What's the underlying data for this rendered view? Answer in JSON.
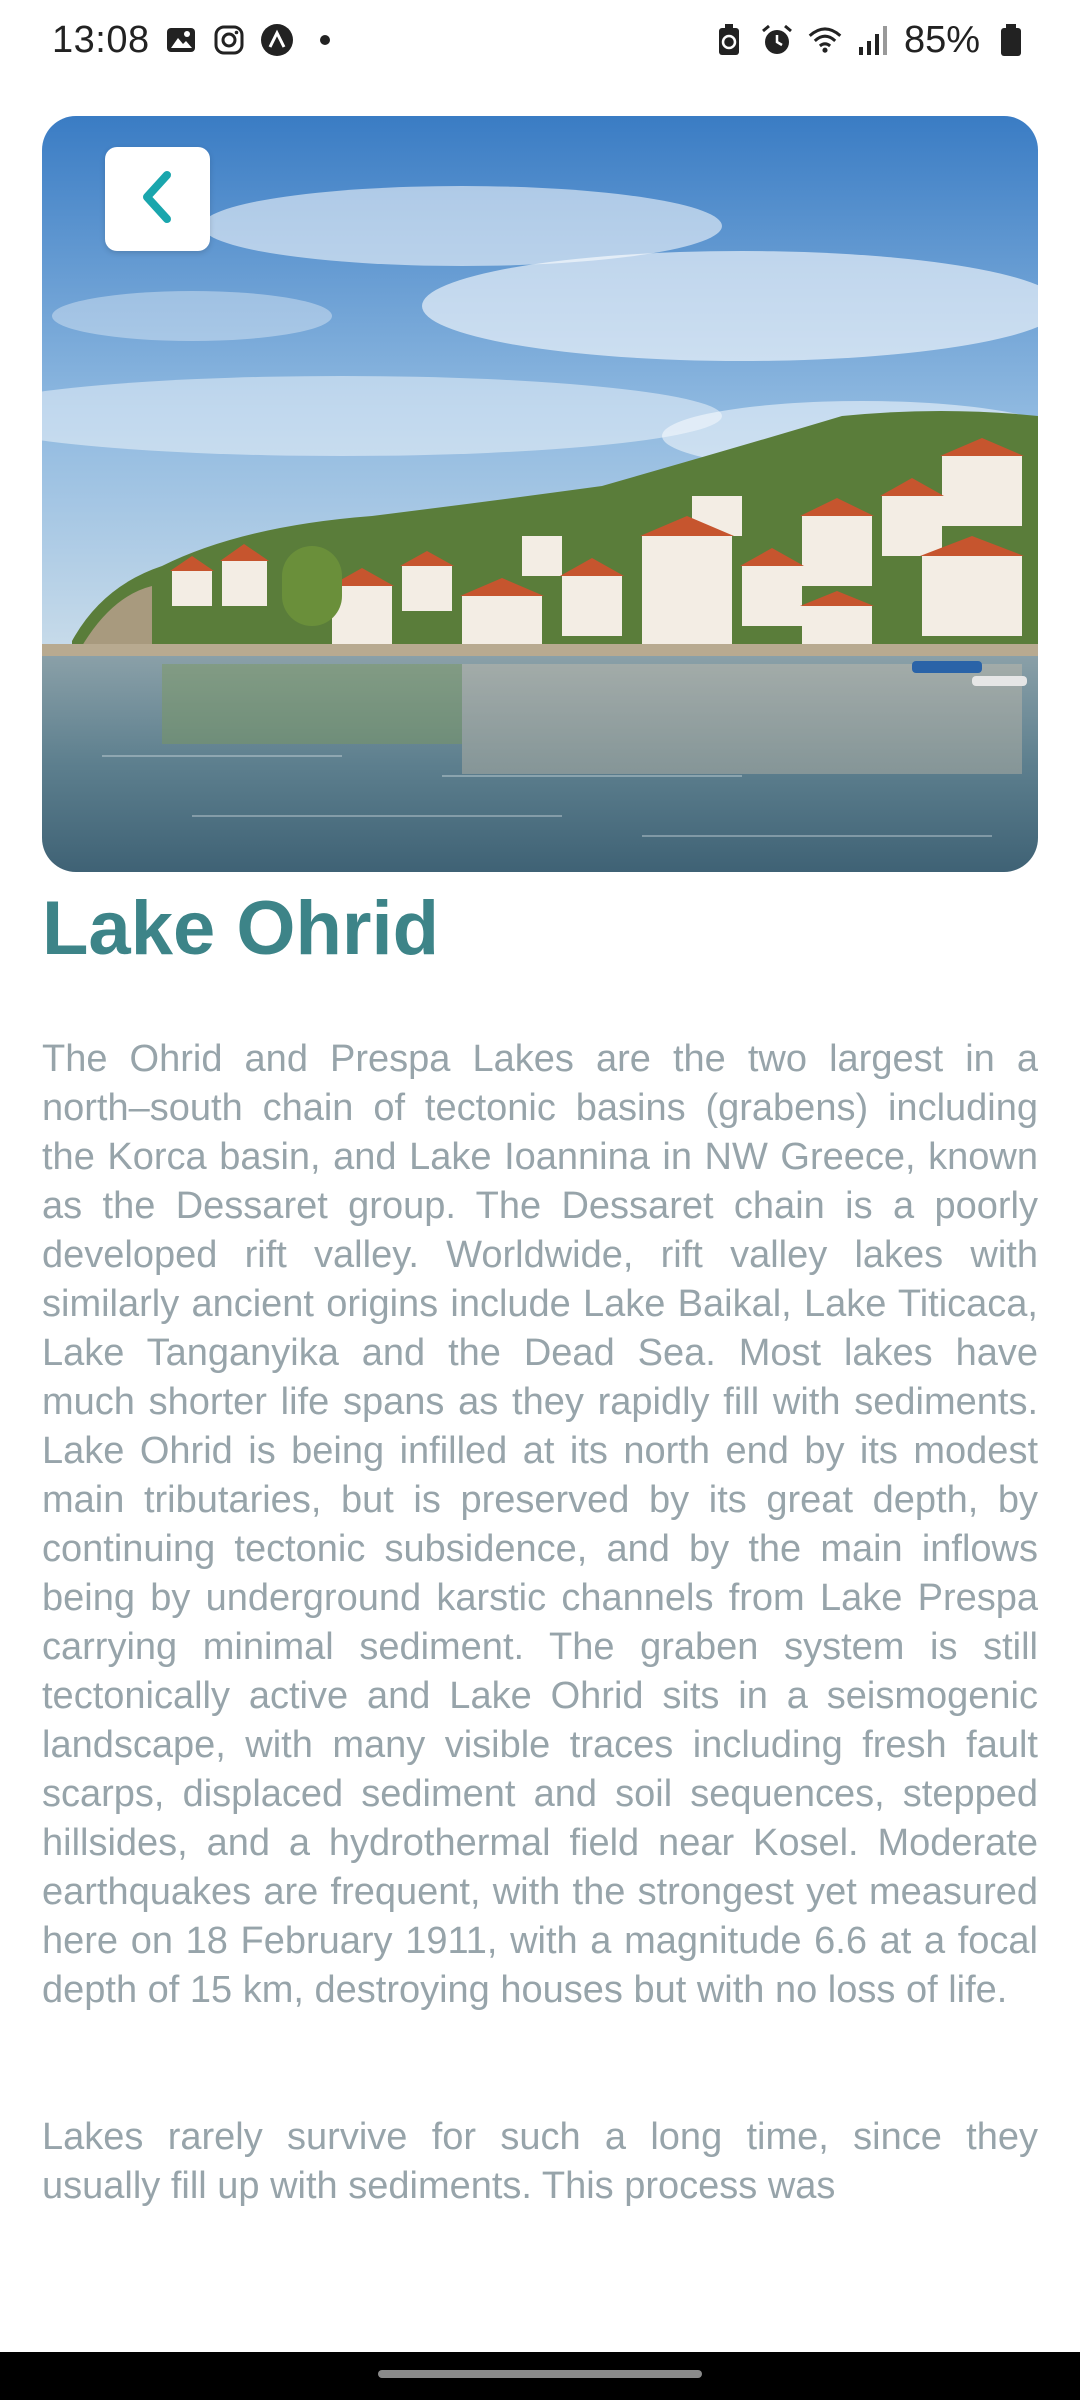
{
  "status_bar": {
    "time": "13:08",
    "left_icons": [
      "gallery-icon",
      "instagram-icon",
      "app-icon",
      "dot-icon"
    ],
    "right_icons": [
      "battery-saver-icon",
      "alarm-icon",
      "wifi-icon",
      "signal-icon",
      "battery-icon"
    ],
    "battery_percent": "85%"
  },
  "hero": {
    "back_icon": "chevron-left-icon",
    "accent_color": "#1aa6ad"
  },
  "title": "Lake Ohrid",
  "paragraphs": [
    "The Ohrid and Prespa Lakes are the two largest in a north–south chain of tectonic basins (grabens) including the Korca basin, and Lake Ioannina in NW Greece, known as the Dessaret group. The Dessaret chain is a poorly developed rift valley. Worldwide, rift valley lakes with similarly ancient origins include Lake Baikal, Lake Titicaca, Lake Tanganyika and the Dead Sea. Most lakes have much shorter life spans as they rapidly fill with sediments. Lake Ohrid is being infilled at its north end by its modest main tributaries, but is preserved by its great depth, by continuing tectonic subsidence, and by the main inflows being by underground karstic channels from Lake Prespa carrying minimal sediment. The graben system is still tectonically active and Lake Ohrid sits in a seismogenic landscape, with many visible traces including fresh fault scarps, displaced sediment and soil sequences, stepped hillsides, and a hydrothermal field near Kosel. Moderate earthquakes are frequent, with the strongest yet measured here on 18 February 1911, with a magnitude 6.6 at a focal depth of 15 km, destroying houses but with no loss of life.",
    "Lakes rarely survive for such a long time, since they usually fill up with sediments. This process was"
  ],
  "colors": {
    "title": "#3d8488",
    "body_text": "#97a4aa"
  }
}
